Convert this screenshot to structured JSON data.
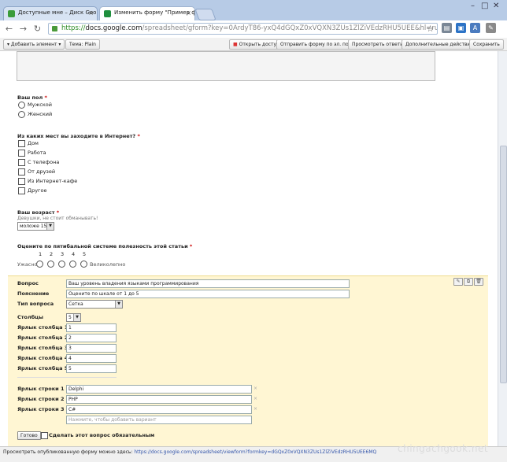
{
  "tabs": [
    {
      "label": "Доступные мне – Диск Goo..."
    },
    {
      "label": "Изменить форму \"Пример ф..."
    }
  ],
  "url": {
    "https": "https://",
    "host": "docs.google.com",
    "rest": "/spreadsheet/gform?key=0ArdyT86-yxQ4dGQxZ0xVQXN3ZUs1ZlZiVEdzRHU5UEE&hl=ru"
  },
  "gbar": {
    "add_item": "Добавить элемент",
    "theme": "Тема:  Plain",
    "open_access": "Открыть доступ",
    "send_form": "Отправить форму по эл. почте",
    "view_answers": "Просмотреть ответы",
    "more_actions": "Дополнительные действия",
    "save": "Сохранить"
  },
  "q_gender": {
    "title": "Ваш пол",
    "req": "*",
    "options": [
      "Мужской",
      "Женский"
    ]
  },
  "q_places": {
    "title": "Из каких мест вы заходите в Интернет?",
    "req": "*",
    "options": [
      "Дом",
      "Работа",
      "С телефона",
      "От друзей",
      "Из Интернет-кафе",
      "Другое"
    ]
  },
  "q_age": {
    "title": "Ваш возраст",
    "req": "*",
    "help": "Девушки, не стоит обманывать!",
    "value": "моложе 15"
  },
  "q_rating": {
    "title": "Оцените по пятибальной системе полезность этой статьи",
    "req": "*",
    "scale": [
      "1",
      "2",
      "3",
      "4",
      "5"
    ],
    "low": "Ужасно",
    "high": "Великолепно"
  },
  "editor": {
    "question_label": "Вопрос",
    "question_value": "Ваш уровень владения языками программирования",
    "explanation_label": "Пояснение",
    "explanation_value": "Оцените по шкале от 1 до 5",
    "type_label": "Тип вопроса",
    "type_value": "Сетка",
    "columns_label": "Столбцы",
    "columns_value": "5",
    "col_labels": [
      {
        "label": "Ярлык столбца 1",
        "value": "1"
      },
      {
        "label": "Ярлык столбца 2",
        "value": "2"
      },
      {
        "label": "Ярлык столбца 3",
        "value": "3"
      },
      {
        "label": "Ярлык столбца 4",
        "value": "4"
      },
      {
        "label": "Ярлык столбца 5",
        "value": "5"
      }
    ],
    "row_labels": [
      {
        "label": "Ярлык строки 1",
        "value": "Delphi"
      },
      {
        "label": "Ярлык строки 2",
        "value": "PHP"
      },
      {
        "label": "Ярлык строки 3",
        "value": "C#"
      }
    ],
    "add_variant_placeholder": "Нажмите, чтобы добавить вариант",
    "done": "Готово",
    "required": "Сделать этот вопрос обязательным"
  },
  "status": {
    "prefix": "Просмотреть опубликованную форму можно здесь: ",
    "url": "https://docs.google.com/spreadsheet/viewform?formkey=dGQxZ0xVQXN3ZUs1ZlZiVEdzRHU5UEE6MQ"
  },
  "watermark": "chingachgook.net",
  "colors": {
    "panel": "#fff6d3",
    "required": "#cc0000",
    "https": "#2a8a23"
  }
}
